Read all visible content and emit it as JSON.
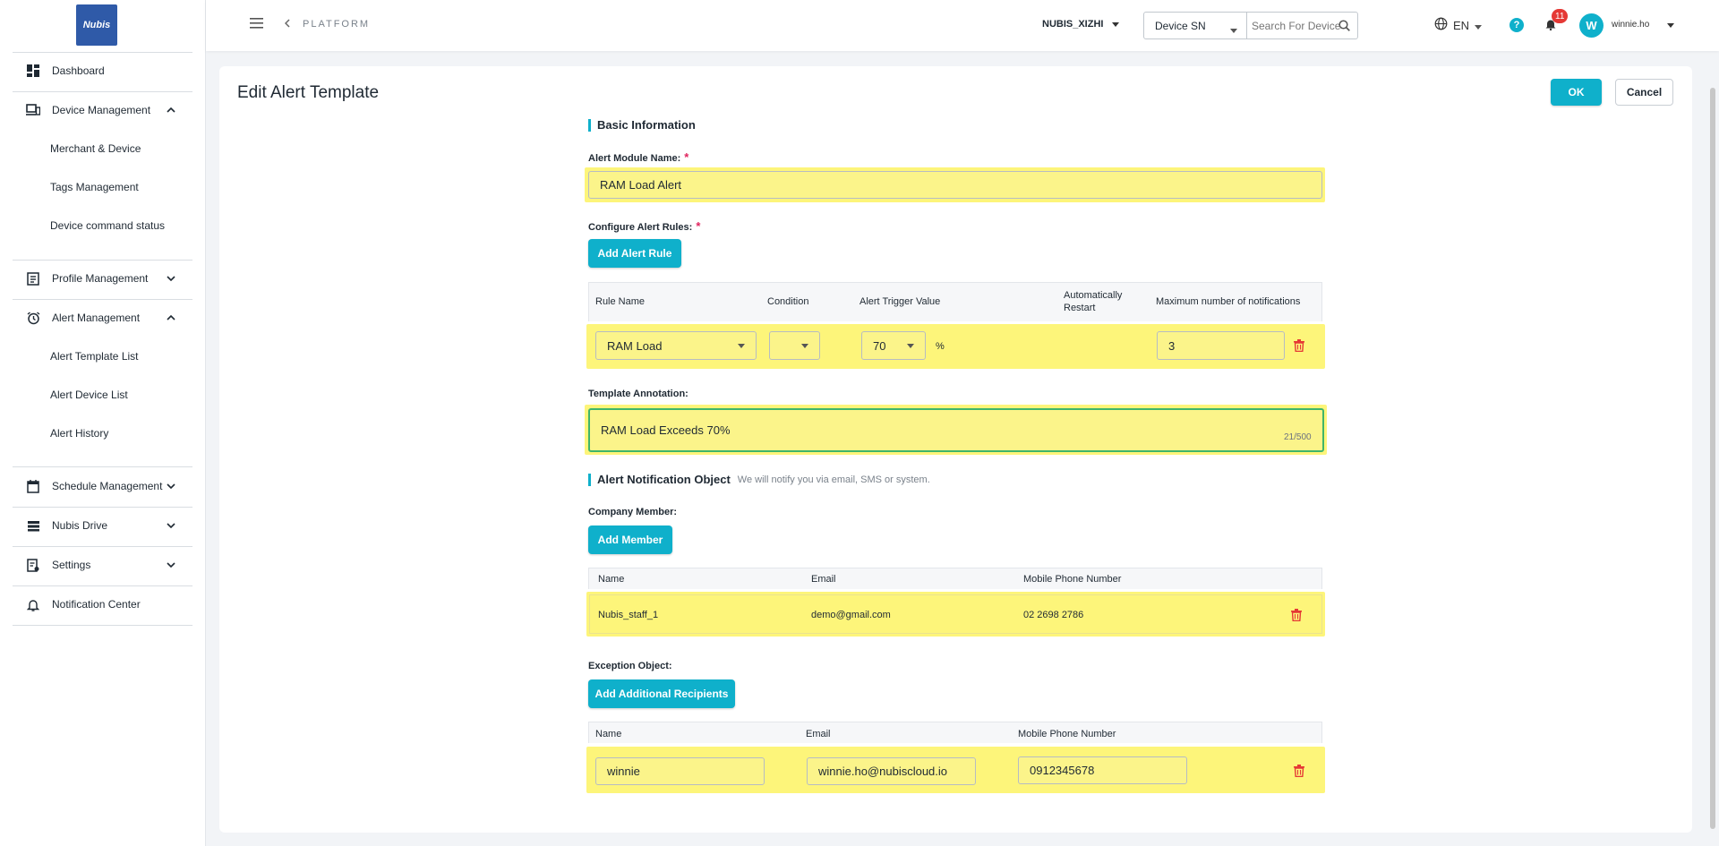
{
  "sidebar": {
    "logo_text": "Nubis",
    "items": [
      {
        "label": "Dashboard",
        "icon": "dashboard-icon"
      },
      {
        "label": "Device Management",
        "icon": "device-icon",
        "expanded": true
      },
      {
        "label": "Merchant & Device"
      },
      {
        "label": "Tags Management"
      },
      {
        "label": "Device command status"
      },
      {
        "label": "Profile Management",
        "icon": "profile-icon",
        "expanded": false
      },
      {
        "label": "Alert Management",
        "icon": "alarm-icon",
        "expanded": true
      },
      {
        "label": "Alert Template List"
      },
      {
        "label": "Alert Device List"
      },
      {
        "label": "Alert History"
      },
      {
        "label": "Schedule Management",
        "icon": "calendar-icon",
        "expanded": false
      },
      {
        "label": "Nubis Drive",
        "icon": "drive-icon",
        "expanded": false
      },
      {
        "label": "Settings",
        "icon": "settings-icon",
        "expanded": false
      },
      {
        "label": "Notification Center",
        "icon": "bell-icon"
      }
    ]
  },
  "topbar": {
    "breadcrumb": "PLATFORM",
    "org": "NUBIS_XIZHI",
    "search_type": "Device SN",
    "search_placeholder": "Search For Devices Across",
    "language": "EN",
    "notification_count": "11",
    "avatar_letter": "W",
    "username": "winnie.ho"
  },
  "page": {
    "title": "Edit Alert Template",
    "ok_label": "OK",
    "cancel_label": "Cancel",
    "basic_info_title": "Basic Information",
    "module_name_label": "Alert Module Name:",
    "module_name_value": "RAM Load Alert",
    "required_mark": "*",
    "rules_label": "Configure Alert Rules:",
    "add_rule_label": "Add Alert Rule",
    "rules_table": {
      "headers": [
        "Rule Name",
        "Condition",
        "Alert Trigger Value",
        "Automatically Restart",
        "Maximum number of notifications"
      ],
      "rows": [
        {
          "rule_name": "RAM Load",
          "condition": "",
          "trigger_value": "70",
          "unit": "%",
          "max_notifications": "3"
        }
      ]
    },
    "annotation_label": "Template Annotation:",
    "annotation_value": "RAM Load Exceeds 70%",
    "annotation_counter": "21/500",
    "notification_title": "Alert Notification Object",
    "notification_hint": "We will notify you via email, SMS or system.",
    "company_member_label": "Company Member:",
    "add_member_label": "Add Member",
    "members_table": {
      "headers": [
        "Name",
        "Email",
        "Mobile Phone Number"
      ],
      "rows": [
        {
          "name": "Nubis_staff_1",
          "email": "demo@gmail.com",
          "phone": "02 2698 2786"
        }
      ]
    },
    "exception_label": "Exception Object:",
    "add_recipients_label": "Add Additional Recipients",
    "exceptions_table": {
      "headers": [
        "Name",
        "Email",
        "Mobile Phone Number"
      ],
      "rows": [
        {
          "name": "winnie",
          "email": "winnie.ho@nubiscloud.io",
          "phone": "0912345678"
        }
      ]
    }
  },
  "colors": {
    "accent": "#0fb0cb",
    "highlight": "#fdf57a",
    "danger": "#e53935",
    "logo": "#2f5aa8"
  }
}
